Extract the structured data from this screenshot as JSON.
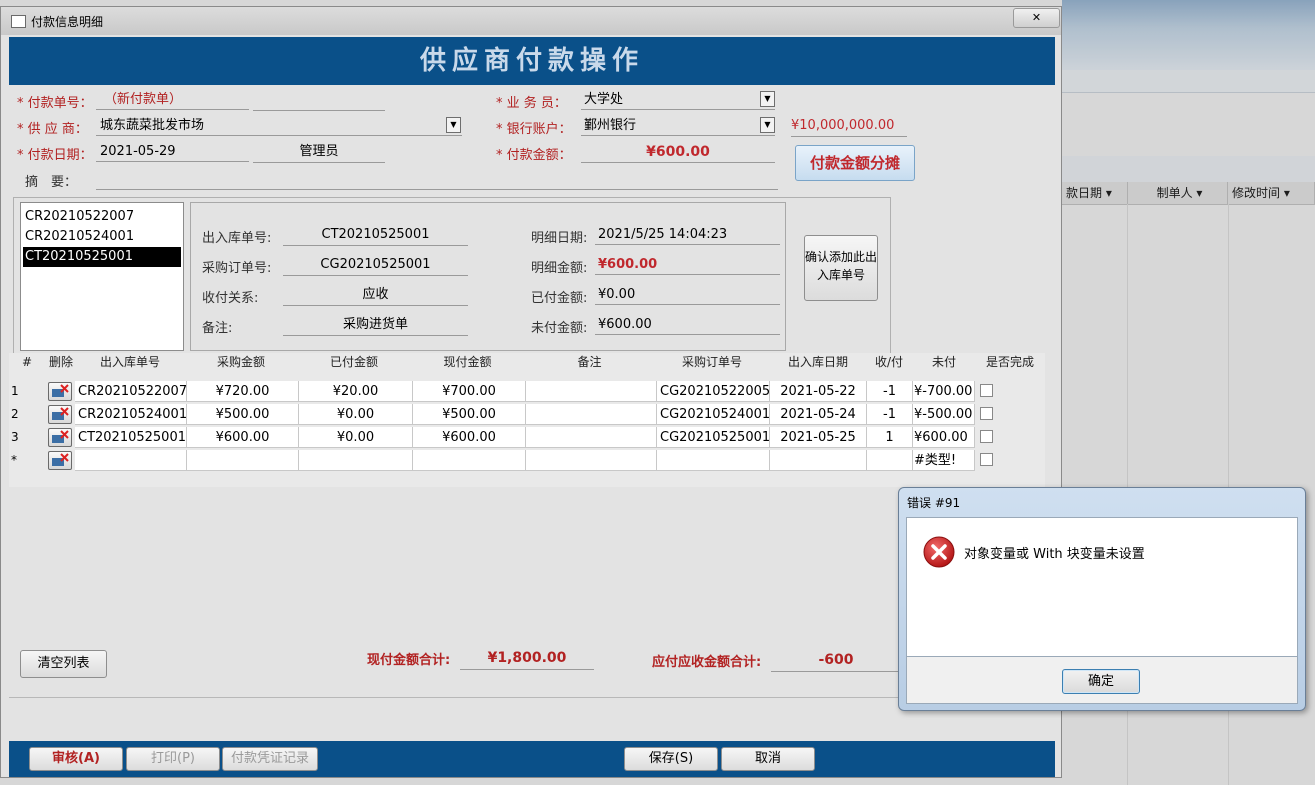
{
  "background_app": {
    "columns": [
      "款日期",
      "制单人",
      "修改时间"
    ]
  },
  "form": {
    "window_title": "付款信息明细",
    "banner_title": "供应商付款操作",
    "labels": {
      "payment_no": "* 付款单号：",
      "supplier": "* 供 应 商：",
      "payment_date": "* 付款日期：",
      "summary": "摘　要：",
      "salesperson": "* 业 务 员：",
      "bank_account": "* 银行账户：",
      "payment_amount": "* 付款金额："
    },
    "values": {
      "payment_no": "（新付款单）",
      "supplier": "城东蔬菜批发市场",
      "payment_date": "2021-05-29",
      "operator": "管理员",
      "summary": "",
      "salesperson": "大学处",
      "bank_account": "鄞州银行",
      "bank_balance": "¥10,000,000.00",
      "payment_amount": "¥600.00"
    },
    "split_button": "付款金额分摊"
  },
  "stock_list": {
    "items": [
      "CR20210522007",
      "CR20210524001",
      "CT20210525001"
    ],
    "selected_index": 2
  },
  "detail": {
    "labels": {
      "stock_no": "出入库单号:",
      "po_no": "采购订单号:",
      "relation": "收付关系:",
      "remark": "备注:",
      "detail_date": "明细日期:",
      "detail_amount": "明细金额:",
      "paid_amount": "已付金额:",
      "unpaid_amount": "未付金额:"
    },
    "values": {
      "stock_no": "CT20210525001",
      "po_no": "CG20210525001",
      "relation": "应收",
      "remark": "采购进货单",
      "detail_date": "2021/5/25 14:04:23",
      "detail_amount": "¥600.00",
      "paid_amount": "¥0.00",
      "unpaid_amount": "¥600.00"
    },
    "confirm_button": "确认添加此出入库单号"
  },
  "table": {
    "headers": [
      "#",
      "删除",
      "出入库单号",
      "采购金额",
      "已付金额",
      "现付金额",
      "备注",
      "采购订单号",
      "出入库日期",
      "收/付",
      "未付",
      "是否完成"
    ],
    "rows": [
      {
        "num": "1",
        "stock_no": "CR20210522007",
        "purchase": "¥720.00",
        "paid": "¥20.00",
        "current": "¥700.00",
        "remark": "",
        "po_no": "CG20210522005",
        "date": "2021-05-22",
        "direction": "-1",
        "unpaid": "¥-700.00"
      },
      {
        "num": "2",
        "stock_no": "CR20210524001",
        "purchase": "¥500.00",
        "paid": "¥0.00",
        "current": "¥500.00",
        "remark": "",
        "po_no": "CG20210524001",
        "date": "2021-05-24",
        "direction": "-1",
        "unpaid": "¥-500.00"
      },
      {
        "num": "3",
        "stock_no": "CT20210525001",
        "purchase": "¥600.00",
        "paid": "¥0.00",
        "current": "¥600.00",
        "remark": "",
        "po_no": "CG20210525001",
        "date": "2021-05-25",
        "direction": "1",
        "unpaid": "¥600.00"
      },
      {
        "num": "*",
        "stock_no": "",
        "purchase": "",
        "paid": "",
        "current": "",
        "remark": "",
        "po_no": "",
        "date": "",
        "direction": "",
        "unpaid": "#类型!"
      }
    ]
  },
  "totals": {
    "clear_button": "清空列表",
    "current_total_label": "现付金额合计:",
    "current_total": "¥1,800.00",
    "receivable_total_label": "应付应收金额合计:",
    "receivable_total": "-600"
  },
  "bottom": {
    "audit": "审核(A)",
    "print": "打印(P)",
    "voucher": "付款凭证记录",
    "save": "保存(S)",
    "cancel": "取消"
  },
  "dialog": {
    "title": "错误 #91",
    "message": "对象变量或 With 块变量未设置",
    "ok": "确定",
    "icon": "error-icon"
  },
  "colors": {
    "banner": "#0a5089",
    "required": "#b22222",
    "amount": "#c0282d"
  }
}
